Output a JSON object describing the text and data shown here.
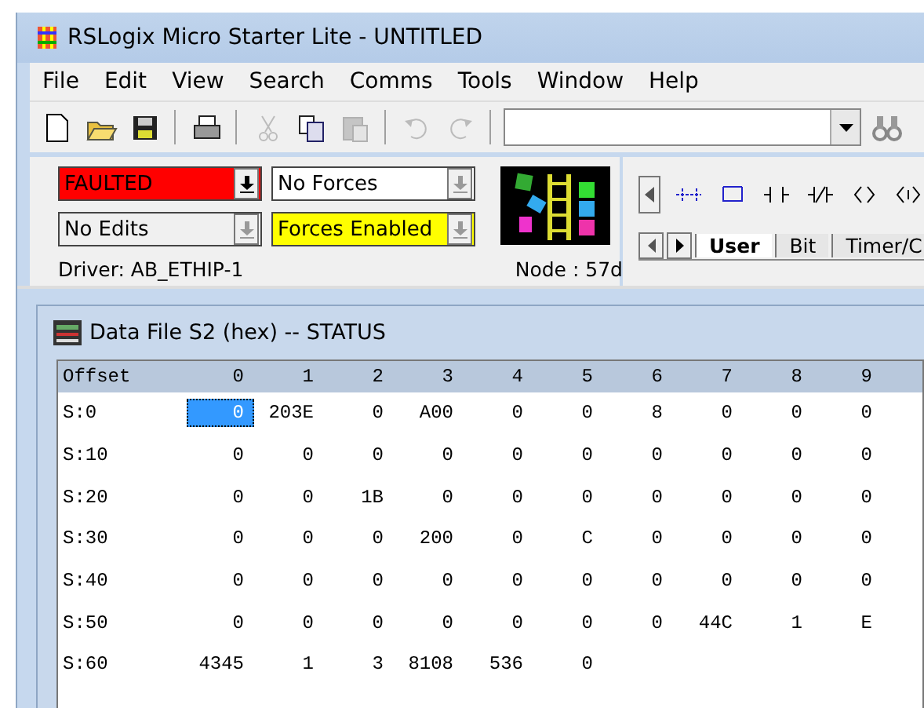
{
  "window": {
    "title": "RSLogix Micro Starter Lite - UNTITLED"
  },
  "menu": [
    "File",
    "Edit",
    "View",
    "Search",
    "Comms",
    "Tools",
    "Window",
    "Help"
  ],
  "toolbar": [
    {
      "kind": "new",
      "disabled": false
    },
    {
      "kind": "open",
      "disabled": false
    },
    {
      "kind": "save",
      "disabled": false
    },
    {
      "kind": "sep"
    },
    {
      "kind": "print",
      "disabled": false
    },
    {
      "kind": "sep"
    },
    {
      "kind": "cut",
      "disabled": true
    },
    {
      "kind": "copy",
      "disabled": false
    },
    {
      "kind": "paste",
      "disabled": true
    },
    {
      "kind": "sep"
    },
    {
      "kind": "undo",
      "disabled": true
    },
    {
      "kind": "redo",
      "disabled": true
    },
    {
      "kind": "sep"
    }
  ],
  "status_panel": {
    "dropdowns": [
      {
        "value": "FAULTED",
        "color": "#ff0000",
        "disabled": false
      },
      {
        "value": "No Forces",
        "color": "#ffffff",
        "disabled": true
      },
      {
        "value": "No Edits",
        "color": "#f0f0f0",
        "disabled": true
      },
      {
        "value": "Forces Enabled",
        "color": "#ffff00",
        "disabled": true
      }
    ],
    "driver": "Driver: AB_ETHIP-1",
    "node": "Node : 57d"
  },
  "instruction_tabs": [
    {
      "label": "User",
      "selected": true
    },
    {
      "label": "Bit",
      "selected": false
    },
    {
      "label": "Timer/C",
      "selected": false
    }
  ],
  "data_window": {
    "title": "Data File S2 (hex)  --  STATUS",
    "columns": [
      "Offset",
      "0",
      "1",
      "2",
      "3",
      "4",
      "5",
      "6",
      "7",
      "8",
      "9"
    ],
    "rows": [
      {
        "cells": [
          {
            "value": "S:0",
            "selected": false
          },
          {
            "value": "0",
            "selected": true
          },
          {
            "value": "203E",
            "selected": false
          },
          {
            "value": "0",
            "selected": false
          },
          {
            "value": "A00",
            "selected": false
          },
          {
            "value": "0",
            "selected": false
          },
          {
            "value": "0",
            "selected": false
          },
          {
            "value": "8",
            "selected": false
          },
          {
            "value": "0",
            "selected": false
          },
          {
            "value": "0",
            "selected": false
          },
          {
            "value": "0",
            "selected": false
          }
        ]
      },
      {
        "cells": [
          {
            "value": "S:10",
            "selected": false
          },
          {
            "value": "0",
            "selected": false
          },
          {
            "value": "0",
            "selected": false
          },
          {
            "value": "0",
            "selected": false
          },
          {
            "value": "0",
            "selected": false
          },
          {
            "value": "0",
            "selected": false
          },
          {
            "value": "0",
            "selected": false
          },
          {
            "value": "0",
            "selected": false
          },
          {
            "value": "0",
            "selected": false
          },
          {
            "value": "0",
            "selected": false
          },
          {
            "value": "0",
            "selected": false
          }
        ]
      },
      {
        "cells": [
          {
            "value": "S:20",
            "selected": false
          },
          {
            "value": "0",
            "selected": false
          },
          {
            "value": "0",
            "selected": false
          },
          {
            "value": "1B",
            "selected": false
          },
          {
            "value": "0",
            "selected": false
          },
          {
            "value": "0",
            "selected": false
          },
          {
            "value": "0",
            "selected": false
          },
          {
            "value": "0",
            "selected": false
          },
          {
            "value": "0",
            "selected": false
          },
          {
            "value": "0",
            "selected": false
          },
          {
            "value": "0",
            "selected": false
          }
        ]
      },
      {
        "cells": [
          {
            "value": "S:30",
            "selected": false
          },
          {
            "value": "0",
            "selected": false
          },
          {
            "value": "0",
            "selected": false
          },
          {
            "value": "0",
            "selected": false
          },
          {
            "value": "200",
            "selected": false
          },
          {
            "value": "0",
            "selected": false
          },
          {
            "value": "C",
            "selected": false
          },
          {
            "value": "0",
            "selected": false
          },
          {
            "value": "0",
            "selected": false
          },
          {
            "value": "0",
            "selected": false
          },
          {
            "value": "0",
            "selected": false
          }
        ]
      },
      {
        "cells": [
          {
            "value": "S:40",
            "selected": false
          },
          {
            "value": "0",
            "selected": false
          },
          {
            "value": "0",
            "selected": false
          },
          {
            "value": "0",
            "selected": false
          },
          {
            "value": "0",
            "selected": false
          },
          {
            "value": "0",
            "selected": false
          },
          {
            "value": "0",
            "selected": false
          },
          {
            "value": "0",
            "selected": false
          },
          {
            "value": "0",
            "selected": false
          },
          {
            "value": "0",
            "selected": false
          },
          {
            "value": "0",
            "selected": false
          }
        ]
      },
      {
        "cells": [
          {
            "value": "S:50",
            "selected": false
          },
          {
            "value": "0",
            "selected": false
          },
          {
            "value": "0",
            "selected": false
          },
          {
            "value": "0",
            "selected": false
          },
          {
            "value": "0",
            "selected": false
          },
          {
            "value": "0",
            "selected": false
          },
          {
            "value": "0",
            "selected": false
          },
          {
            "value": "0",
            "selected": false
          },
          {
            "value": "44C",
            "selected": false
          },
          {
            "value": "1",
            "selected": false
          },
          {
            "value": "E",
            "selected": false
          }
        ]
      },
      {
        "cells": [
          {
            "value": "S:60",
            "selected": false
          },
          {
            "value": "4345",
            "selected": false
          },
          {
            "value": "1",
            "selected": false
          },
          {
            "value": "3",
            "selected": false
          },
          {
            "value": "8108",
            "selected": false
          },
          {
            "value": "536",
            "selected": false
          },
          {
            "value": "0",
            "selected": false
          }
        ]
      }
    ]
  }
}
